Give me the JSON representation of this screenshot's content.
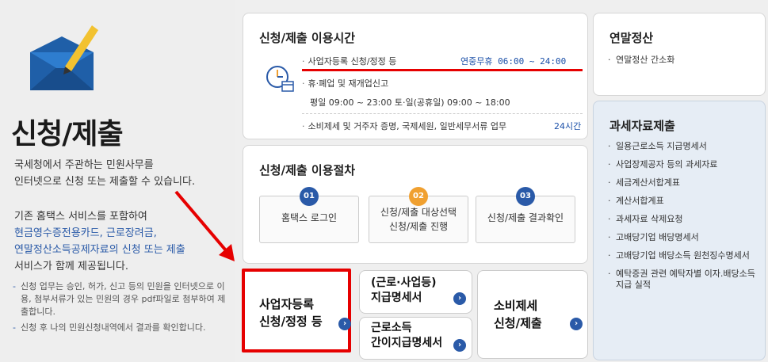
{
  "left": {
    "title": "신청/제출",
    "intro_line1": "국세청에서 주관하는 민원사무를",
    "intro_line2": "인터넷으로 신청 또는 제출할 수 있습니다.",
    "intro2_line1": "기존 홈택스 서비스를 포함하여",
    "intro2_line2": "현금영수증전용카드, 근로장려금,",
    "intro2_line3": "연말정산소득공제자료의 신청 또는 제출",
    "intro2_line4": "서비스가 함께 제공됩니다.",
    "note1": "신청 업무는 승인, 허가, 신고 등의 민원을 인터넷으로 이용, 첨부서류가 있는 민원의 경우 pdf파일로 첨부하여 제출합니다.",
    "note2": "신청 후 나의 민원신청내역에서 결과를 확인합니다."
  },
  "time": {
    "title": "신청/제출 이용시간",
    "row1_label": "사업자등록 신청/정정 등",
    "row1_value": "연중무휴 06:00 ~ 24:00",
    "row2_label": "휴·폐업 및 재개업신고",
    "row3_text": "평일 09:00 ~ 23:00 토·일(공휴일) 09:00 ~ 18:00",
    "row4_label": "소비제세 및 거주자 증명, 국제세원, 일반세무서류 업무",
    "row4_value": "24시간"
  },
  "procedure": {
    "title": "신청/제출 이용절차",
    "steps": [
      {
        "num": "01",
        "label": "홈택스 로그인"
      },
      {
        "num": "02",
        "line1": "신청/제출 대상선택",
        "line2": "신청/제출 진행"
      },
      {
        "num": "03",
        "label": "신청/제출 결과확인"
      }
    ]
  },
  "buttons": {
    "b1_line1": "사업자등록",
    "b1_line2": "신청/정정 등",
    "b2_line1": "(근로·사업등)",
    "b2_line2": "지급명세서",
    "b3_line1": "근로소득",
    "b3_line2": "간이지급명세서",
    "b4_line1": "소비제세",
    "b4_line2": "신청/제출"
  },
  "yearend": {
    "title": "연말정산",
    "items": [
      "연말정산 간소화"
    ]
  },
  "tax": {
    "title": "과세자료제출",
    "items": [
      "일용근로소득 지급명세서",
      "사업장제공자 등의 과세자료",
      "세금계산서합계표",
      "계산서합계표",
      "과세자료 삭제요청",
      "고배당기업 배당명세서",
      "고배당기업 배당소득 원천징수명세서",
      "예탁증권 관련 예탁자별 이자.배당소득 지급 실적"
    ]
  },
  "colors": {
    "accent": "#2a5aa8",
    "highlight": "#e60000",
    "step2": "#f0a030"
  }
}
